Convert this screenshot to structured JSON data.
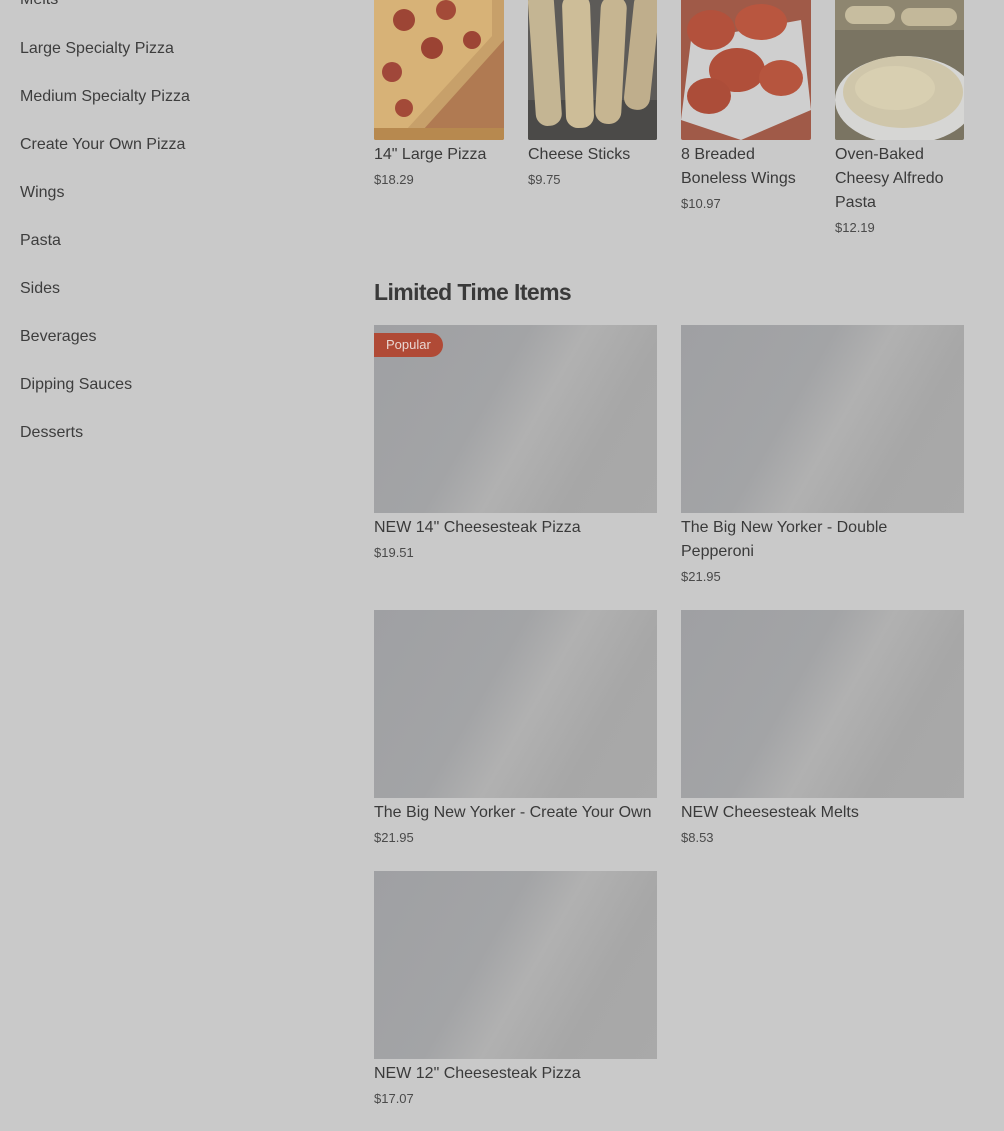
{
  "sidebar": {
    "items": [
      {
        "label": "Melts"
      },
      {
        "label": "Large Specialty Pizza"
      },
      {
        "label": "Medium Specialty Pizza"
      },
      {
        "label": "Create Your Own Pizza"
      },
      {
        "label": "Wings"
      },
      {
        "label": "Pasta"
      },
      {
        "label": "Sides"
      },
      {
        "label": "Beverages"
      },
      {
        "label": "Dipping Sauces"
      },
      {
        "label": "Desserts"
      }
    ]
  },
  "top_items": [
    {
      "name": "14\" Large Pizza",
      "price": "$18.29"
    },
    {
      "name": "Cheese Sticks",
      "price": "$9.75"
    },
    {
      "name": "8 Breaded Boneless Wings",
      "price": "$10.97"
    },
    {
      "name": "Oven-Baked Cheesy Alfredo Pasta",
      "price": "$12.19"
    }
  ],
  "limited": {
    "title": "Limited Time Items",
    "badge": "Popular",
    "items": [
      {
        "name": "NEW 14\" Cheesesteak Pizza",
        "price": "$19.51"
      },
      {
        "name": "The Big New Yorker - Double Pepperoni",
        "price": "$21.95"
      },
      {
        "name": "The Big New Yorker - Create Your Own",
        "price": "$21.95"
      },
      {
        "name": "NEW Cheesesteak Melts",
        "price": "$8.53"
      },
      {
        "name": "NEW 12\" Cheesesteak Pizza",
        "price": "$17.07"
      }
    ]
  },
  "colors": {
    "overlay": "#c9c9c9",
    "badge": "#b04a36"
  }
}
